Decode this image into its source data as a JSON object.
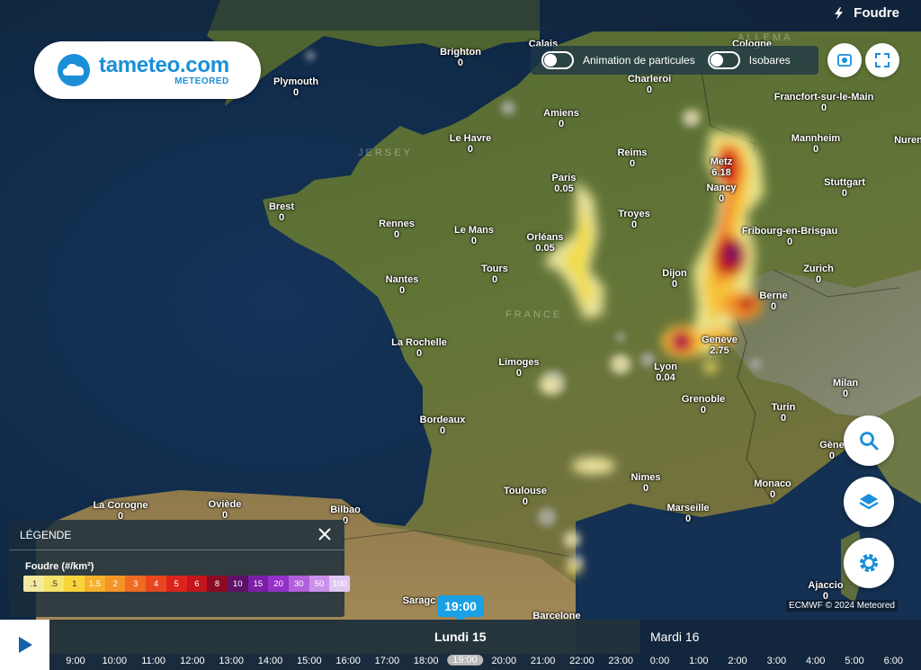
{
  "app": {
    "logo_main": "tameteo.com",
    "logo_sub": "METEORED",
    "layer_title": "Foudre"
  },
  "toggles": [
    {
      "label": "Animation de particules",
      "on": false
    },
    {
      "label": "Isobares",
      "on": false
    }
  ],
  "icons": {
    "layer": "lightning-bolt-icon",
    "screenshot": "camera-icon",
    "fullscreen": "expand-icon",
    "search": "search-icon",
    "layers": "layers-icon",
    "settings": "gear-icon",
    "play": "play-icon",
    "close": "close-icon"
  },
  "cities": [
    {
      "name": "Calais",
      "value": ""
    },
    {
      "name": "Brighton",
      "value": "0"
    },
    {
      "name": "Cologne",
      "value": ""
    },
    {
      "name": "Plymouth",
      "value": "0"
    },
    {
      "name": "Charleroi",
      "value": "0"
    },
    {
      "name": "Francfort-sur-le-Main",
      "value": "0"
    },
    {
      "name": "Amiens",
      "value": "0"
    },
    {
      "name": "Le Havre",
      "value": "0"
    },
    {
      "name": "Reims",
      "value": "0"
    },
    {
      "name": "Mannheim",
      "value": "0"
    },
    {
      "name": "Nuren",
      "value": ""
    },
    {
      "name": "Metz",
      "value": "6.18"
    },
    {
      "name": "Paris",
      "value": "0.05"
    },
    {
      "name": "Nancy",
      "value": "0"
    },
    {
      "name": "Stuttgart",
      "value": "0"
    },
    {
      "name": "Brest",
      "value": "0"
    },
    {
      "name": "Troyes",
      "value": "0"
    },
    {
      "name": "Rennes",
      "value": "0"
    },
    {
      "name": "Le Mans",
      "value": "0"
    },
    {
      "name": "Orléans",
      "value": "0.05"
    },
    {
      "name": "Fribourg-en-Brisgau",
      "value": "0"
    },
    {
      "name": "Tours",
      "value": "0"
    },
    {
      "name": "Dijon",
      "value": "0"
    },
    {
      "name": "Zurich",
      "value": "0"
    },
    {
      "name": "Nantes",
      "value": "0"
    },
    {
      "name": "Berne",
      "value": "0"
    },
    {
      "name": "Genève",
      "value": "2.75"
    },
    {
      "name": "La Rochelle",
      "value": "0"
    },
    {
      "name": "Limoges",
      "value": "0"
    },
    {
      "name": "Lyon",
      "value": "0.04"
    },
    {
      "name": "Milan",
      "value": "0"
    },
    {
      "name": "Grenoble",
      "value": "0"
    },
    {
      "name": "Turin",
      "value": "0"
    },
    {
      "name": "Bordeaux",
      "value": "0"
    },
    {
      "name": "Gène",
      "value": "0"
    },
    {
      "name": "Nimes",
      "value": "0"
    },
    {
      "name": "Toulouse",
      "value": "0"
    },
    {
      "name": "Monaco",
      "value": "0"
    },
    {
      "name": "La Corogne",
      "value": "0"
    },
    {
      "name": "Oviède",
      "value": "0"
    },
    {
      "name": "Bilbao",
      "value": "0"
    },
    {
      "name": "Marseille",
      "value": "0"
    },
    {
      "name": "Ajaccio",
      "value": "0"
    },
    {
      "name": "Saragc",
      "value": ""
    },
    {
      "name": "Barcelone",
      "value": ""
    }
  ],
  "regions": {
    "jersey": "JERSEY",
    "france": "FRANCE",
    "allemagne": "ALLEMA"
  },
  "legend": {
    "title": "LÉGENDE",
    "subtitle": "Foudre (#/km²)",
    "scale": [
      {
        "label": ".1",
        "color": "#f3eaa0"
      },
      {
        "label": ".5",
        "color": "#f7e26a"
      },
      {
        "label": "1",
        "color": "#f7d53a"
      },
      {
        "label": "1.5",
        "color": "#f5b12a"
      },
      {
        "label": "2",
        "color": "#f39425"
      },
      {
        "label": "3",
        "color": "#ee6b22"
      },
      {
        "label": "4",
        "color": "#e8461f"
      },
      {
        "label": "5",
        "color": "#dc241d"
      },
      {
        "label": "6",
        "color": "#c4141c"
      },
      {
        "label": "8",
        "color": "#8b0a23"
      },
      {
        "label": "10",
        "color": "#5d1266"
      },
      {
        "label": "15",
        "color": "#7a1fa6"
      },
      {
        "label": "20",
        "color": "#9530c9"
      },
      {
        "label": "30",
        "color": "#b160dc"
      },
      {
        "label": "50",
        "color": "#c992e8"
      },
      {
        "label": "100",
        "color": "#e1c8f3"
      }
    ]
  },
  "copyright": "ECMWF © 2024 Meteored",
  "timeline": {
    "current_time": "19:00",
    "day1": "Lundi 15",
    "day2": "Mardi 16",
    "hours": [
      "9:00",
      "10:00",
      "11:00",
      "12:00",
      "13:00",
      "14:00",
      "15:00",
      "16:00",
      "17:00",
      "18:00",
      "19:00",
      "20:00",
      "21:00",
      "22:00",
      "23:00",
      "0:00",
      "1:00",
      "2:00",
      "3:00",
      "4:00",
      "5:00",
      "6:00"
    ],
    "selected_hour": "19:00"
  }
}
